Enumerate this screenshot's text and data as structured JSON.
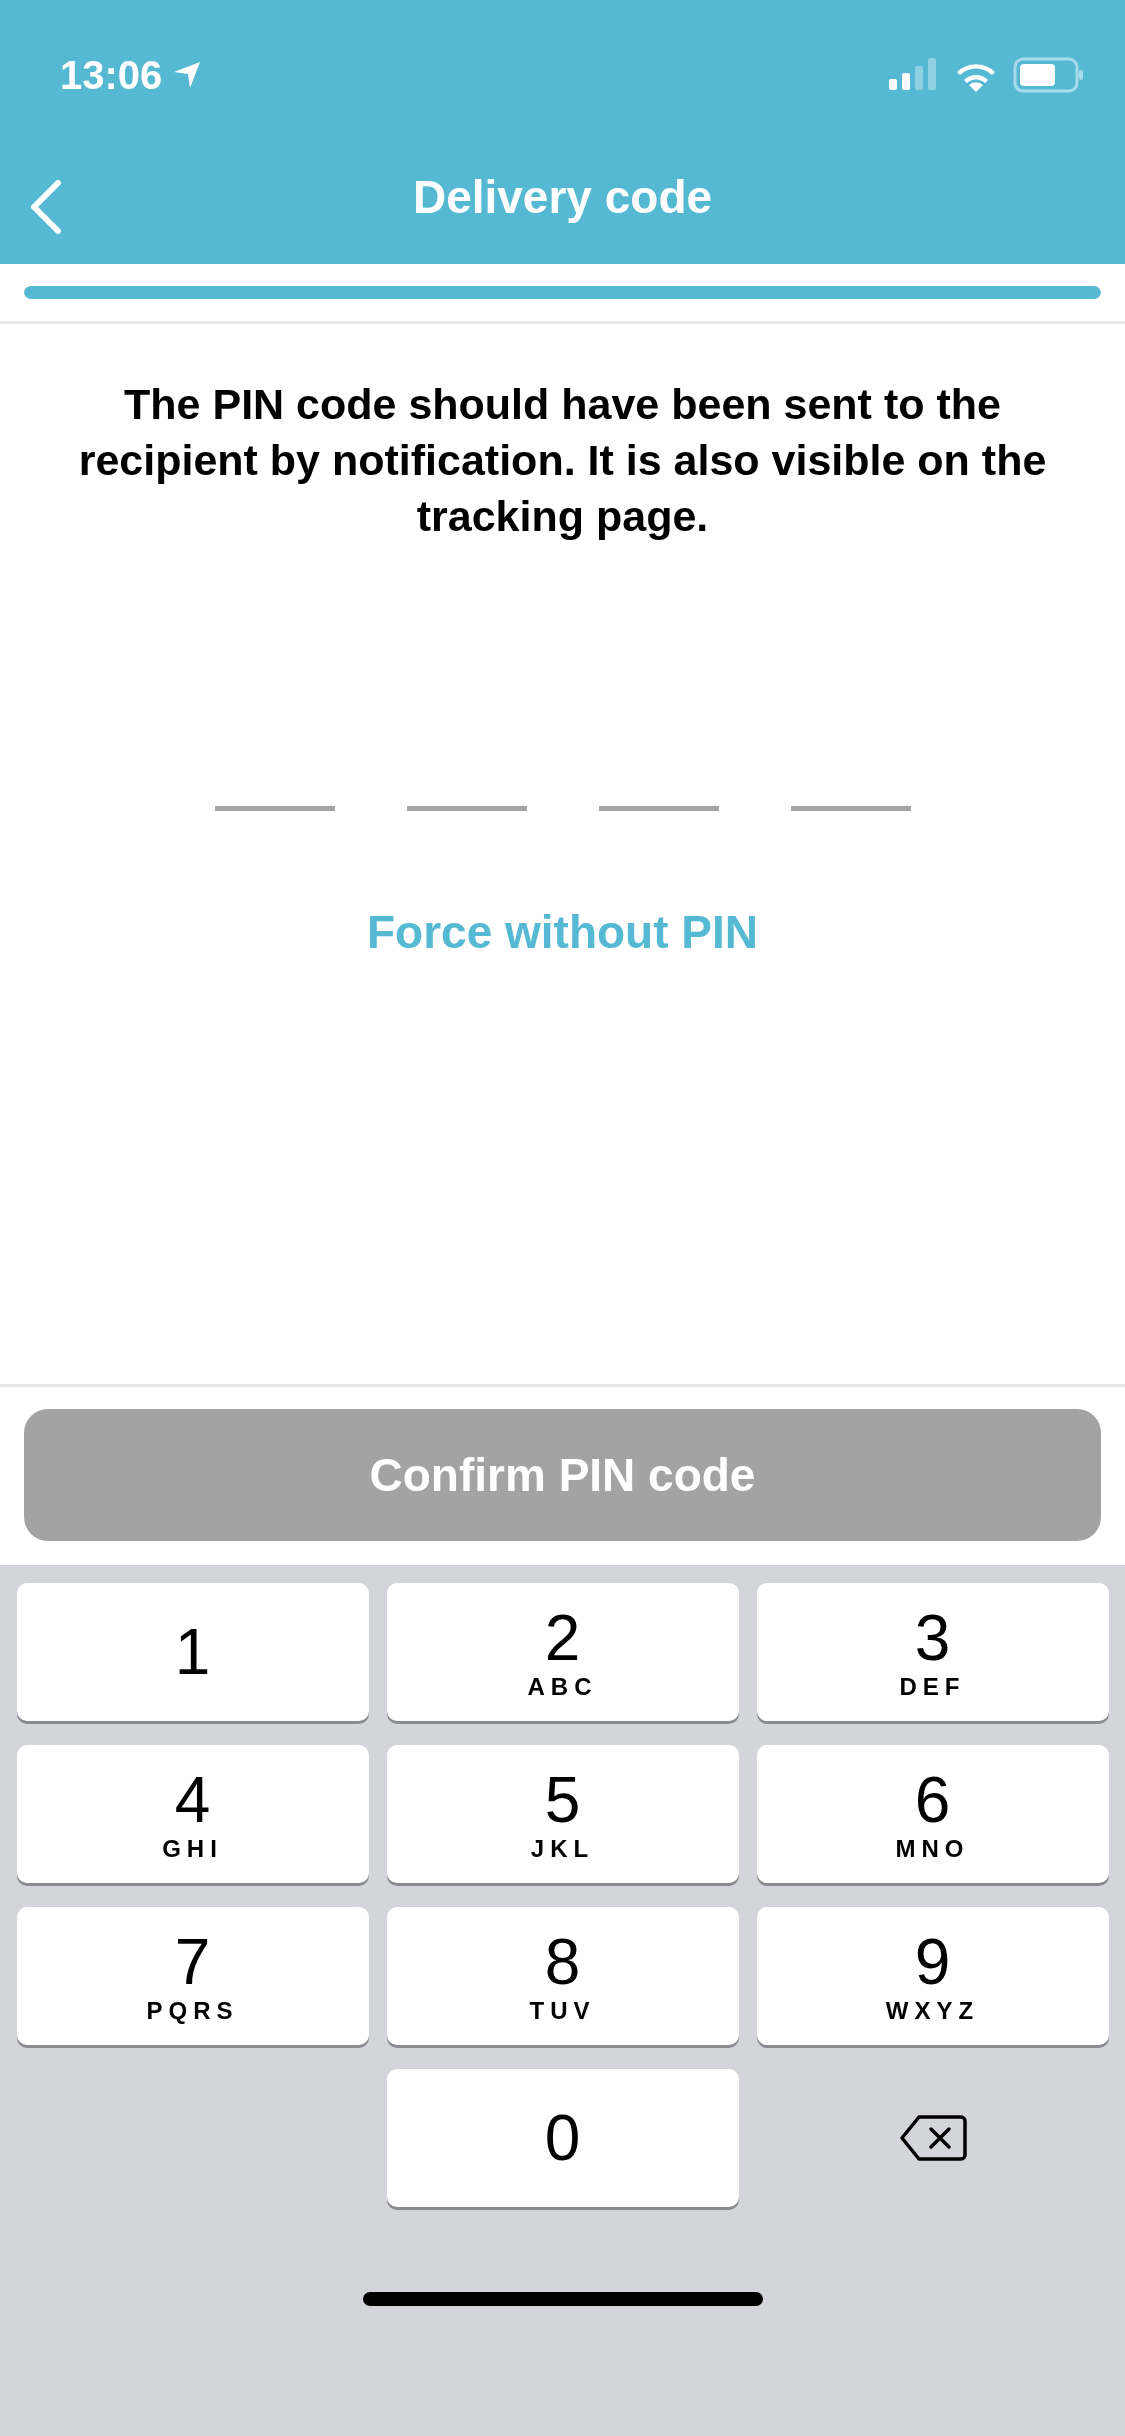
{
  "status_bar": {
    "time": "13:06"
  },
  "nav": {
    "title": "Delivery code"
  },
  "progress": {
    "level": 1
  },
  "instructions": "The PIN code should have been sent to the recipient by notification. It is also visible on the tracking page.",
  "pin_slots": [
    {
      "filled": false
    },
    {
      "filled": false
    },
    {
      "filled": false
    },
    {
      "filled": false
    }
  ],
  "force_link": "Force without PIN",
  "confirm_button": {
    "label": "Confirm PIN code",
    "disabled": true
  },
  "keypad": [
    {
      "kind": "digit",
      "digit": "1"
    },
    {
      "kind": "digit",
      "digit": "2",
      "letters": "ABC"
    },
    {
      "kind": "digit",
      "digit": "3",
      "letters": "DEF"
    },
    {
      "kind": "digit",
      "digit": "4",
      "letters": "GHI"
    },
    {
      "kind": "digit",
      "digit": "5",
      "letters": "JKL"
    },
    {
      "kind": "digit",
      "digit": "6",
      "letters": "MNO"
    },
    {
      "kind": "digit",
      "digit": "7",
      "letters": "PQRS"
    },
    {
      "kind": "digit",
      "digit": "8",
      "letters": "TUV"
    },
    {
      "kind": "digit",
      "digit": "9",
      "letters": "WXYZ"
    },
    {
      "kind": "blank"
    },
    {
      "kind": "digit",
      "digit": "0"
    },
    {
      "kind": "delete"
    }
  ]
}
